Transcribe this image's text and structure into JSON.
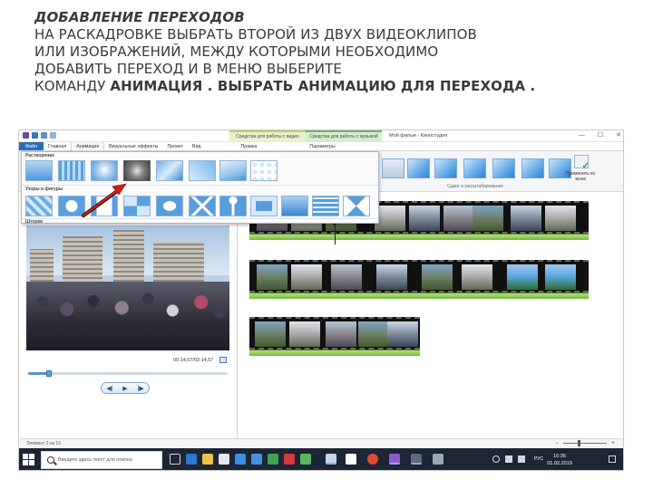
{
  "slide": {
    "title_line1": "ДОБАВЛЕНИЕ ПЕРЕХОДОВ",
    "line2": "НА РАСКАДРОВКЕ ВЫБРАТЬ ВТОРОЙ ИЗ ДВУХ ВИДЕОКЛИПОВ",
    "line3": "ИЛИ ИЗОБРАЖЕНИЙ, МЕЖДУ КОТОРЫМИ НЕОБХОДИМО",
    "line4": "ДОБАВИТЬ ПЕРЕХОД И В МЕНЮ  ВЫБЕРИТЕ",
    "line5_normal": "КОМАНДУ ",
    "line5_bold": "АНИМАЦИЯ . ВЫБРАТЬ АНИМАЦИЮ ДЛЯ ПЕРЕХОДА ."
  },
  "app": {
    "window_title": "Мой фильм - Киностудия",
    "context_tab_video": "Средства для работы с видео",
    "context_tab_music": "Средства для работы с музыкой",
    "window_controls": {
      "minimize": "—",
      "maximize": "☐",
      "close": "✕"
    },
    "tabs": [
      {
        "label": "Файл"
      },
      {
        "label": "Главная"
      },
      {
        "label": "Анимация"
      },
      {
        "label": "Визуальные эффекты"
      },
      {
        "label": "Проект"
      },
      {
        "label": "Вид"
      },
      {
        "label": "Правка"
      },
      {
        "label": "Параметры"
      }
    ],
    "ribbon": {
      "group_label": "Сдвиг и масштабирование",
      "apply_all_label": "Применить ко всем"
    },
    "gallery": {
      "section1": "Растворение",
      "section2": "Узоры и фигуры",
      "section3": "Шторки"
    },
    "preview": {
      "timecode": "00:14,07/02:14,57",
      "play_controls": {
        "prev": "◀|",
        "play": "▶",
        "next": "|▶"
      }
    },
    "status": {
      "left": "Элемент 2 из 15",
      "zoom_minus": "−",
      "zoom_plus": "+"
    },
    "taskbar": {
      "search_placeholder": "Введите здесь текст для поиска",
      "clock_time": "16:35",
      "clock_date": "01.02.2019",
      "language": "РУС"
    }
  },
  "colors": {
    "heading_text": "#3a3a3a",
    "file_tab": "#2a6fb6",
    "context_video": "#e9f2c8",
    "context_music": "#d8ecd0",
    "audio_track": "#74ba3c",
    "taskbar": "#1c2635",
    "arrow": "#d01c1c"
  },
  "icons": {
    "search": "search-icon",
    "start": "windows-start-icon",
    "apply_all": "apply-all-icon",
    "fullscreen": "fullscreen-icon",
    "playhead": "playhead-marker"
  }
}
